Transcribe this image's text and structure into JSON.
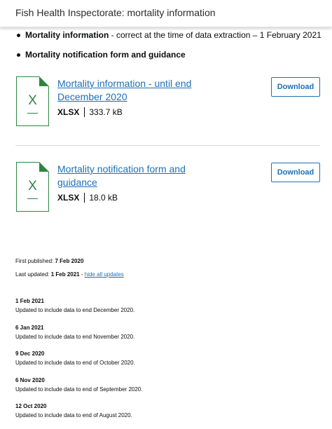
{
  "header": {
    "title": "Fish Health Inspectorate: mortality information"
  },
  "bullets": [
    {
      "bold": "Mortality information",
      "rest": " - correct at the time of data extraction – 1 February 2021"
    },
    {
      "bold": "Mortality notification form and guidance",
      "rest": ""
    }
  ],
  "attachments": [
    {
      "title": "Mortality information - until end December 2020",
      "format": "XLSX",
      "size": "333.7 kB",
      "button": "Download",
      "icon": "excel-file-icon"
    },
    {
      "title": "Mortality notification form and guidance",
      "format": "XLSX",
      "size": "18.0 kB",
      "button": "Download",
      "icon": "excel-file-icon"
    }
  ],
  "meta": {
    "published_label": "First published:",
    "published_date": "7 Feb 2020",
    "updated_label": "Last updated:",
    "updated_date": "1 Feb 2021",
    "updated_sep": " - ",
    "hide_updates_link": "hide all updates"
  },
  "history": [
    {
      "date": "1 Feb 2021",
      "note": "Updated to include data to end December 2020."
    },
    {
      "date": "6 Jan 2021",
      "note": "Updated to include data to end November 2020."
    },
    {
      "date": "9 Dec 2020",
      "note": "Updated to include data to end of October 2020."
    },
    {
      "date": "6 Nov 2020",
      "note": "Updated to include data to end of September 2020."
    },
    {
      "date": "12 Oct 2020",
      "note": "Updated to include data to end of August 2020."
    }
  ],
  "colors": {
    "link": "#1d70b8",
    "excel_green": "#2e8540",
    "text": "#0b0c0c"
  }
}
